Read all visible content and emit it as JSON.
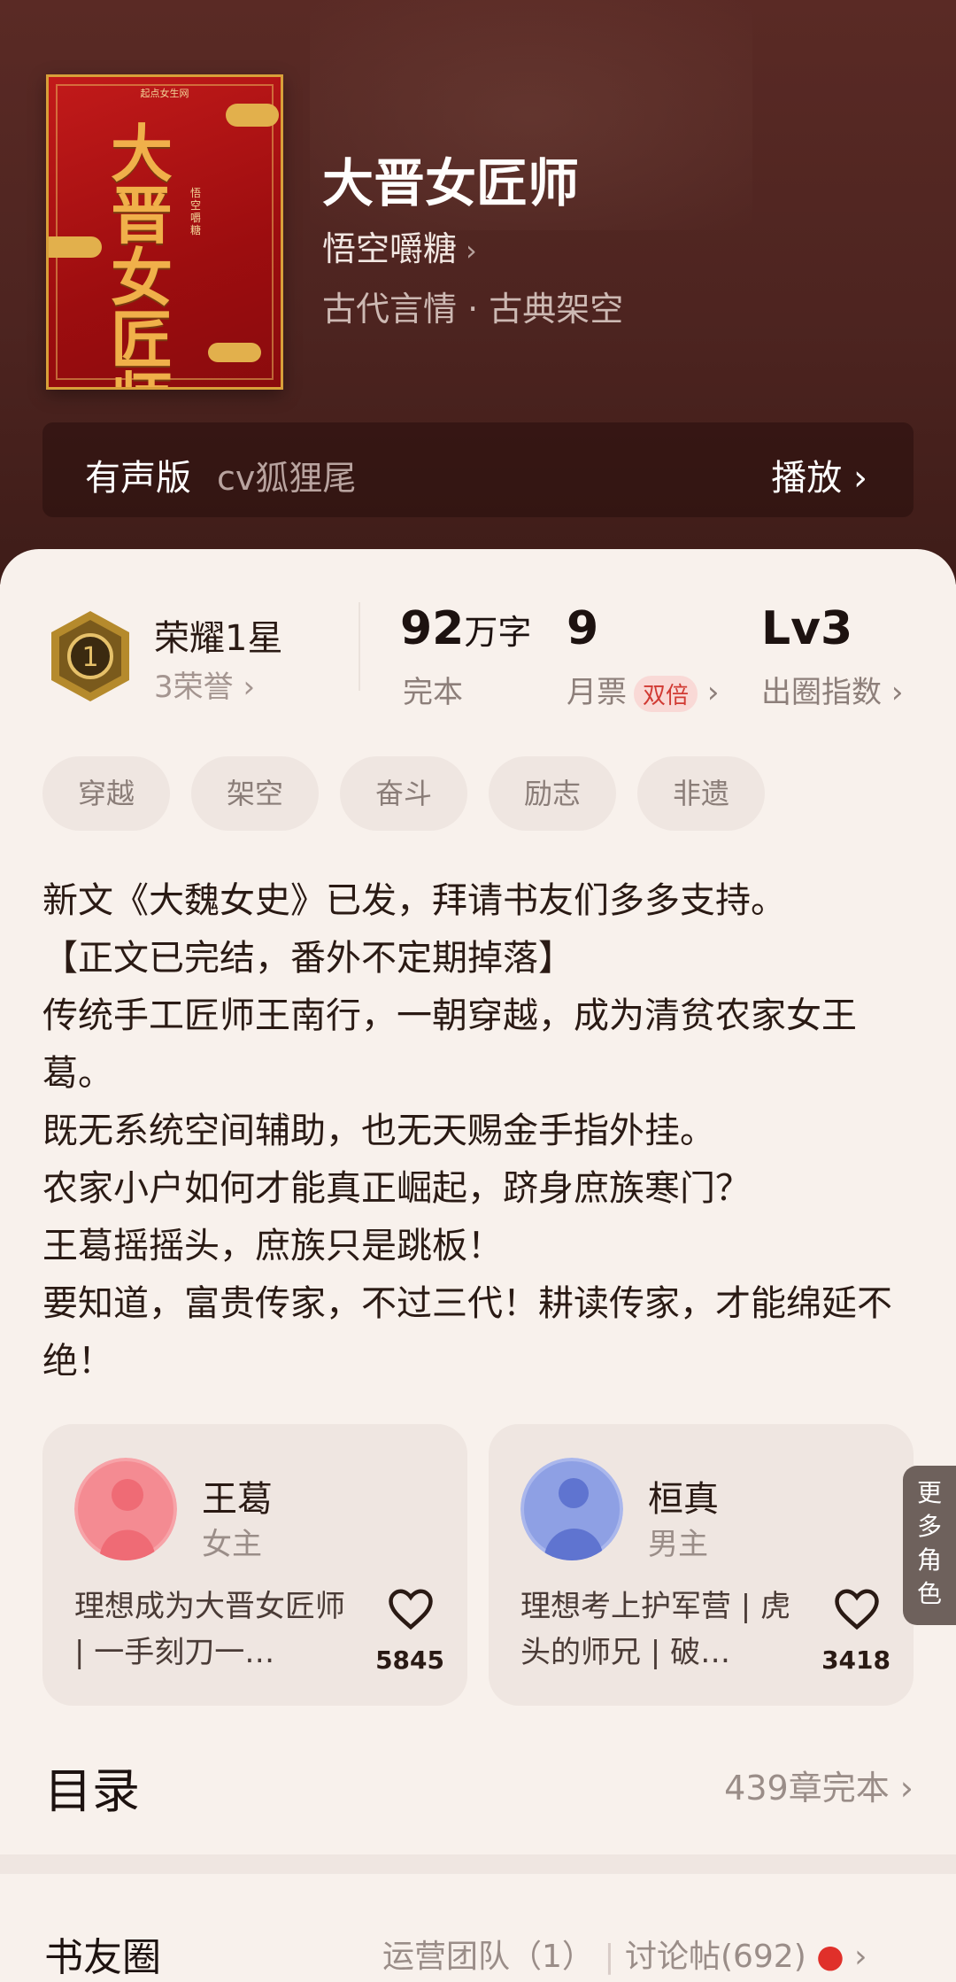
{
  "book": {
    "title": "大晋女匠师",
    "author": "悟空嚼糖",
    "genre": "古代言情 · 古典架空",
    "cover": {
      "publisher": "起点女生网",
      "title_art": "大晋女匠师",
      "author_art": "悟空嚼糖"
    }
  },
  "audio": {
    "label": "有声版",
    "narrator": "cv狐狸尾",
    "play_label": "播放"
  },
  "honor": {
    "title": "荣耀1星",
    "sub": "3荣誉"
  },
  "stats": {
    "words": {
      "value": "92",
      "unit": "万字",
      "label": "完本"
    },
    "tickets": {
      "value": "9",
      "label": "月票",
      "badge": "双倍"
    },
    "influence": {
      "value": "Lv3",
      "label": "出圈指数"
    }
  },
  "tags": [
    "穿越",
    "架空",
    "奋斗",
    "励志",
    "非遗"
  ],
  "description": [
    "新文《大魏女史》已发，拜请书友们多多支持。",
    "【正文已完结，番外不定期掉落】",
    "传统手工匠师王南行，一朝穿越，成为清贫农家女王葛。",
    "既无系统空间辅助，也无天赐金手指外挂。",
    "农家小户如何才能真正崛起，跻身庶族寒门？",
    "王葛摇摇头，庶族只是跳板！",
    "要知道，富贵传家，不过三代！耕读传家，才能绵延不绝！"
  ],
  "characters": [
    {
      "name": "王葛",
      "role": "女主",
      "desc": "理想成为大晋女匠师 | 一手刻刀一…",
      "likes": "5845"
    },
    {
      "name": "桓真",
      "role": "男主",
      "desc": "理想考上护军营 | 虎头的师兄 | 破…",
      "likes": "3418"
    }
  ],
  "more_roles": "更多角色",
  "toc": {
    "label": "目录",
    "status": "439章完本"
  },
  "circle": {
    "label": "书友圈",
    "team": "运营团队（1）",
    "posts": "讨论帖(692)"
  },
  "colors": {
    "hero_bg": "#4d2420",
    "page_bg": "#f8f1ec",
    "badge_red": "#d13a33",
    "fire": "#e0302a"
  }
}
